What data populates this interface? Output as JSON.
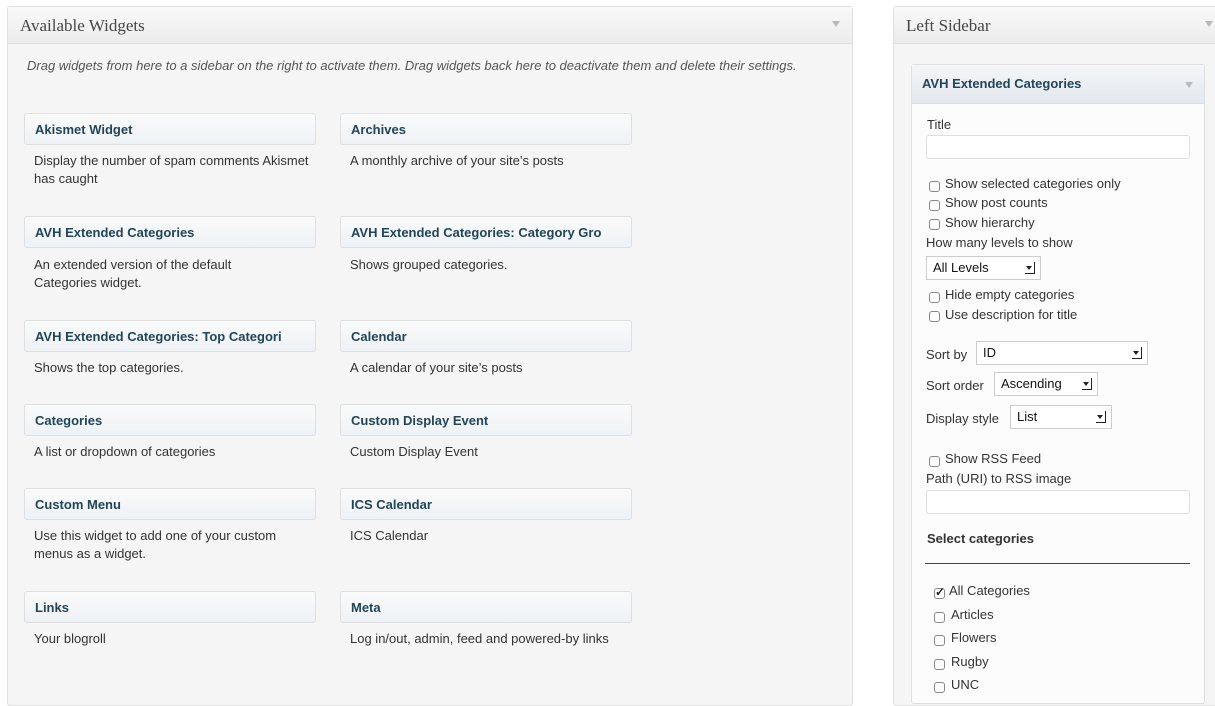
{
  "available": {
    "title": "Available Widgets",
    "description": "Drag widgets from here to a sidebar on the right to activate them. Drag widgets back here to deactivate them and delete their settings.",
    "widgets": [
      {
        "name": "Akismet Widget",
        "desc": "Display the number of spam comments Akismet has caught"
      },
      {
        "name": "Archives",
        "desc": "A monthly archive of your site’s posts"
      },
      {
        "name": "AVH Extended Categories",
        "desc": "An extended version of the default Categories widget."
      },
      {
        "name": "AVH Extended Categories: Category Gro",
        "desc": "Shows grouped categories."
      },
      {
        "name": "AVH Extended Categories: Top Categori",
        "desc": "Shows the top categories."
      },
      {
        "name": "Calendar",
        "desc": "A calendar of your site’s posts"
      },
      {
        "name": "Categories",
        "desc": "A list or dropdown of categories"
      },
      {
        "name": "Custom Display Event",
        "desc": "Custom Display Event"
      },
      {
        "name": "Custom Menu",
        "desc": "Use this widget to add one of your custom menus as a widget."
      },
      {
        "name": "ICS Calendar",
        "desc": "ICS Calendar"
      },
      {
        "name": "Links",
        "desc": "Your blogroll"
      },
      {
        "name": "Meta",
        "desc": "Log in/out, admin, feed and powered-by links"
      }
    ]
  },
  "sidebar": {
    "title": "Left Sidebar",
    "widget_title": "AVH Extended Categories",
    "title_label": "Title",
    "title_value": "",
    "opt_selected_only": "Show selected categories only",
    "opt_post_counts": "Show post counts",
    "opt_hierarchy": "Show hierarchy",
    "levels_label": "How many levels to show",
    "levels_value": "All Levels",
    "opt_hide_empty": "Hide empty categories",
    "opt_desc_title": "Use description for title",
    "sort_by_label": "Sort by",
    "sort_by_value": "ID",
    "sort_order_label": "Sort order",
    "sort_order_value": "Ascending",
    "display_style_label": "Display style",
    "display_style_value": "List",
    "opt_rss": "Show RSS Feed",
    "rss_path_label": "Path (URI) to RSS image",
    "rss_path_value": "",
    "select_categories_label": "Select categories",
    "categories": [
      {
        "label": "All Categories",
        "checked": true
      },
      {
        "label": "Articles",
        "checked": false
      },
      {
        "label": "Flowers",
        "checked": false
      },
      {
        "label": "Rugby",
        "checked": false
      },
      {
        "label": "UNC",
        "checked": false
      }
    ]
  }
}
